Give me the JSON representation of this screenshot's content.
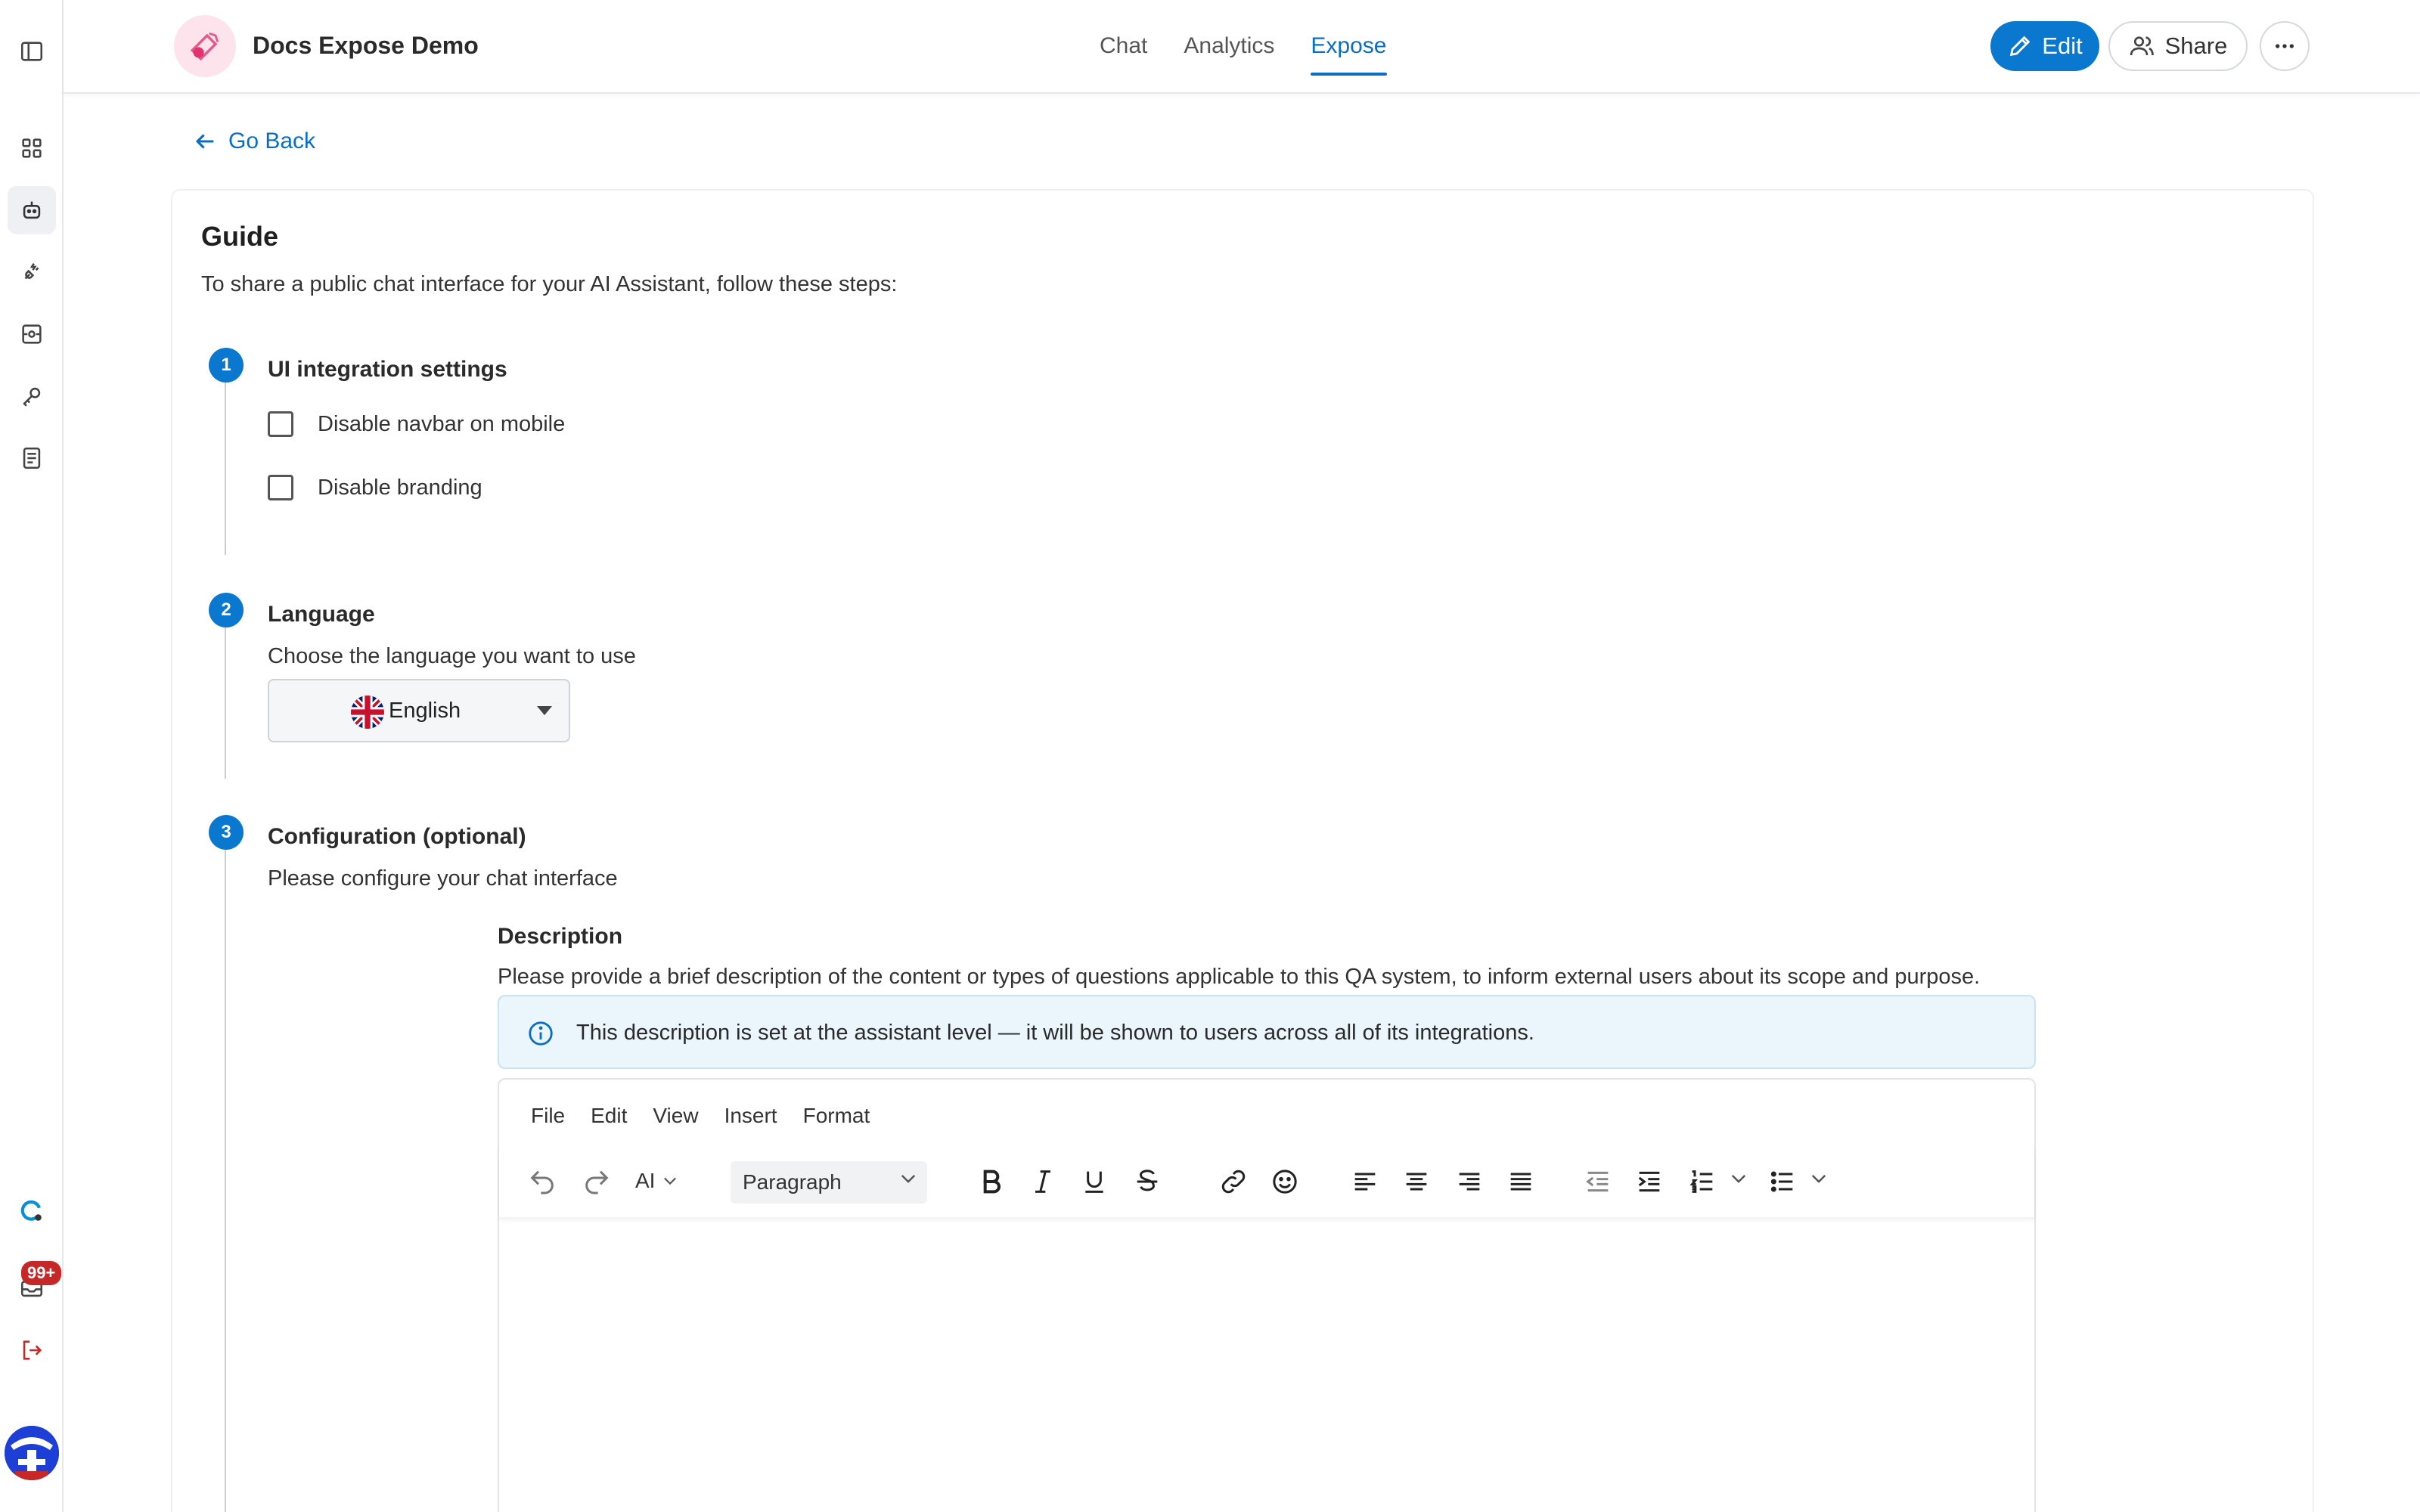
{
  "header": {
    "app_title": "Docs Expose Demo",
    "tabs": [
      {
        "label": "Chat",
        "active": false
      },
      {
        "label": "Analytics",
        "active": false
      },
      {
        "label": "Expose",
        "active": true
      }
    ],
    "edit_label": "Edit",
    "share_label": "Share"
  },
  "sidebar": {
    "items": [
      {
        "icon": "sidebar-toggle-icon"
      },
      {
        "icon": "grid-icon"
      },
      {
        "icon": "robot-icon",
        "active": true
      },
      {
        "icon": "plug-icon"
      },
      {
        "icon": "scan-icon"
      },
      {
        "icon": "key-icon"
      },
      {
        "icon": "document-icon"
      }
    ],
    "bottom": {
      "badge": "99+"
    }
  },
  "page": {
    "back_label": "Go Back",
    "guide_title": "Guide",
    "guide_desc": "To share a public chat interface for your AI Assistant, follow these steps:"
  },
  "steps": [
    {
      "number": "1",
      "title": "UI integration settings",
      "options": [
        {
          "label": "Disable navbar on mobile",
          "checked": false
        },
        {
          "label": "Disable branding",
          "checked": false
        }
      ]
    },
    {
      "number": "2",
      "title": "Language",
      "subtitle": "Choose the language you want to use",
      "language": "English"
    },
    {
      "number": "3",
      "title": "Configuration (optional)",
      "subtitle": "Please configure your chat interface"
    }
  ],
  "description": {
    "title": "Description",
    "subtitle": "Please provide a brief description of the content or types of questions applicable to this QA system, to inform external users about its scope and purpose.",
    "info": "This description is set at the assistant level — it will be shown to users across all of its integrations."
  },
  "editor": {
    "menu": [
      "File",
      "Edit",
      "View",
      "Insert",
      "Format"
    ],
    "ai_label": "AI",
    "block_format": "Paragraph"
  },
  "colors": {
    "accent": "#0b78d0",
    "badge": "#c62828",
    "info_bg": "#eaf5fc"
  }
}
